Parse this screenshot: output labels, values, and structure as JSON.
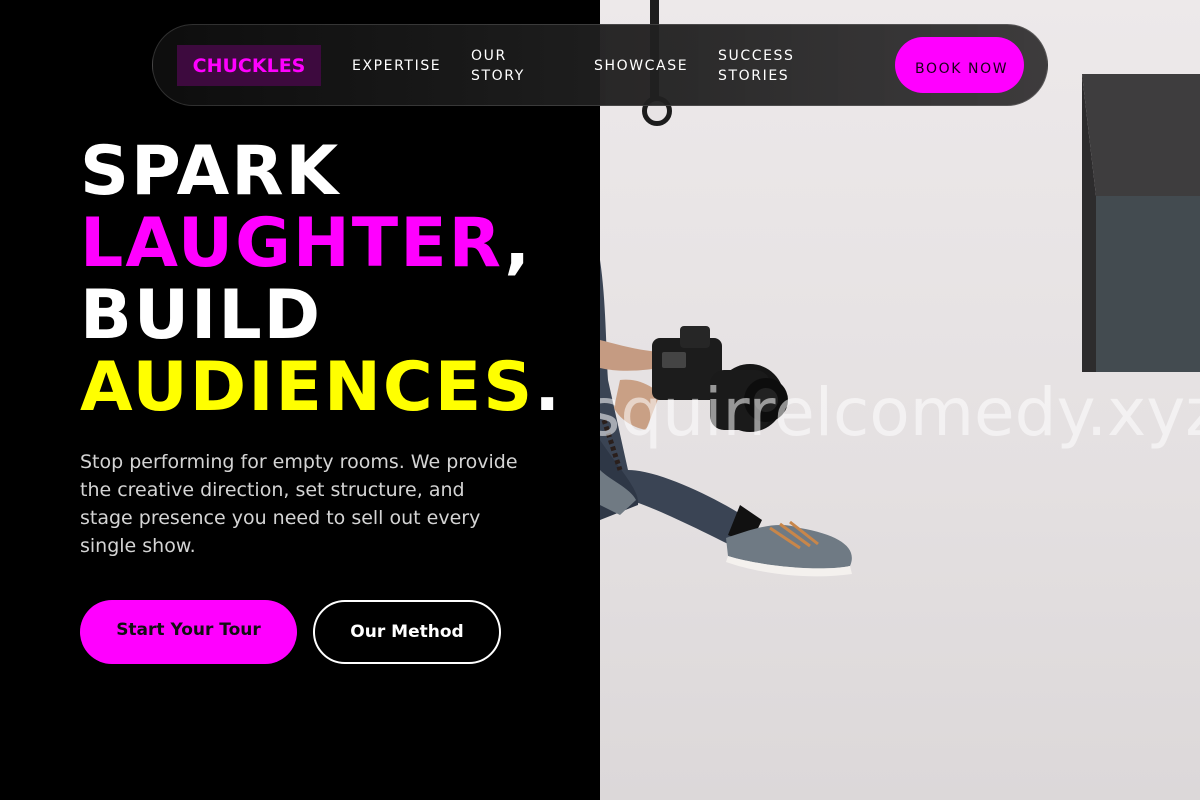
{
  "nav": {
    "logo": "CHUCKLES",
    "links": [
      "EXPERTISE",
      "OUR STORY",
      "SHOWCASE",
      "SUCCESS STORIES"
    ],
    "cta": "BOOK NOW"
  },
  "hero": {
    "headline": {
      "line1": "SPARK",
      "line2_highlight": "LAUGHTER",
      "line2_rest": ",",
      "line3": "BUILD",
      "line4_highlight": "AUDIENCES",
      "line4_rest": "."
    },
    "subcopy": "Stop performing for empty rooms. We provide the creative direction, set structure, and stage presence you need to sell out every single show.",
    "primary_cta": "Start Your Tour",
    "secondary_cta": "Our Method"
  },
  "image": {
    "watermark": "squirrelcomedy.xyz",
    "alt": "photographer-with-camera"
  },
  "colors": {
    "accent_magenta": "#ff00ff",
    "accent_yellow": "#ffff00",
    "background": "#000000",
    "logo_bg": "#3d0a3e"
  }
}
